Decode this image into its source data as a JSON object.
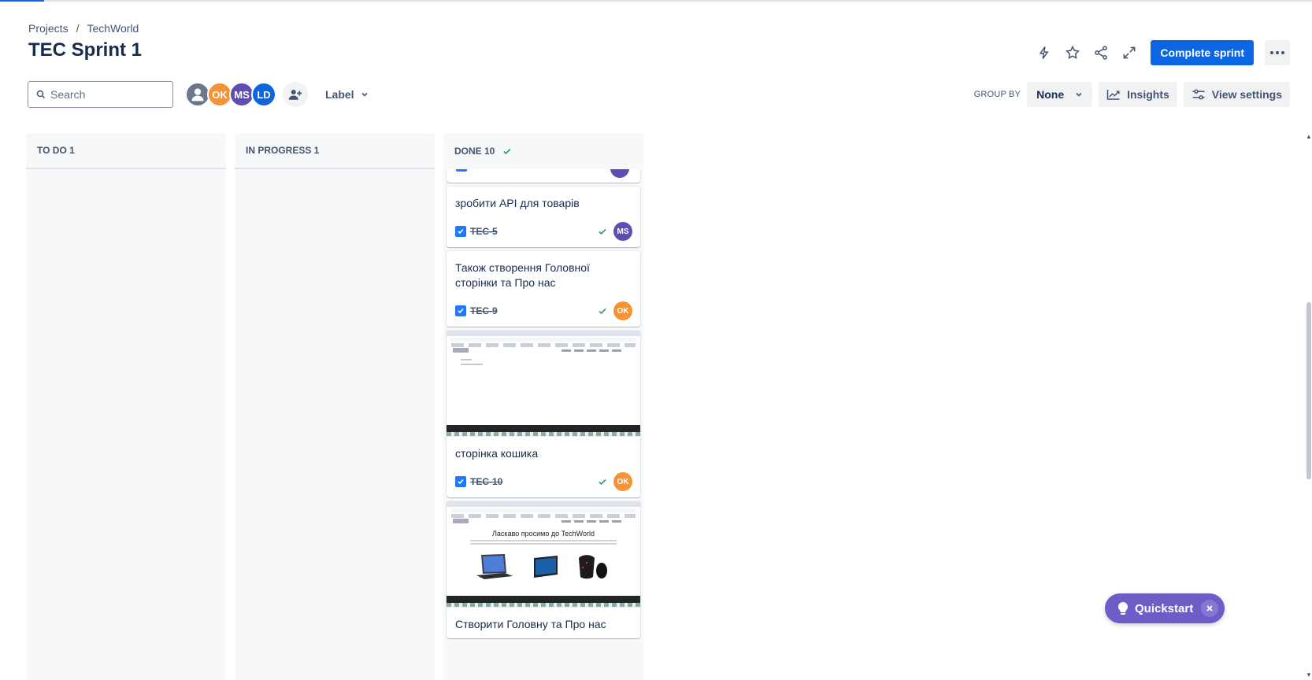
{
  "breadcrumb": {
    "projects": "Projects",
    "separator": "/",
    "project": "TechWorld"
  },
  "page": {
    "title": "TEC Sprint 1"
  },
  "header": {
    "complete_sprint": "Complete sprint"
  },
  "toolbar": {
    "search_placeholder": "Search",
    "avatars": [
      {
        "initials": "OK",
        "color": "#f79233"
      },
      {
        "initials": "MS",
        "color": "#5e4db2"
      },
      {
        "initials": "LD",
        "color": "#0c66e4"
      }
    ],
    "label_filter": "Label",
    "group_by_label": "GROUP BY",
    "group_by_value": "None",
    "insights": "Insights",
    "view_settings": "View settings"
  },
  "columns": [
    {
      "title": "TO DO 1"
    },
    {
      "title": "IN PROGRESS 1"
    },
    {
      "title": "DONE 10"
    }
  ],
  "cards": [
    {
      "title": "зробити API для товарів",
      "key": "TEC-5",
      "assignee": "MS",
      "assignee_color": "#5e4db2"
    },
    {
      "title": "Також створення Головної сторінки та Про нас",
      "key": "TEC-9",
      "assignee": "OK",
      "assignee_color": "#f79233"
    },
    {
      "title": "сторінка кошика",
      "key": "TEC-10",
      "assignee": "OK",
      "assignee_color": "#f79233"
    },
    {
      "title": "Створити Головну та Про нас"
    }
  ],
  "thumbnail": {
    "headline": "Ласкаво просимо до TechWorld"
  },
  "quickstart": {
    "label": "Quickstart"
  },
  "colors": {
    "primary": "#0c66e4",
    "done_green": "#22a06b",
    "quickstart": "#6e5dc6"
  }
}
